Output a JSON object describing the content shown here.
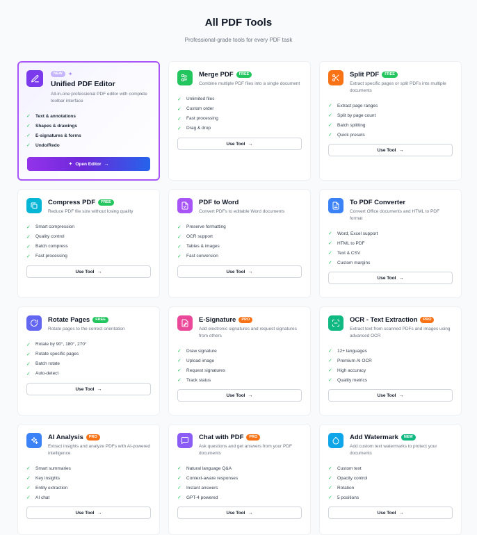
{
  "header": {
    "title": "All PDF Tools",
    "subtitle": "Professional-grade tools for every PDF task"
  },
  "colors": {
    "free": "#22c55e",
    "pro": "#f97316",
    "new": "#10b981",
    "accent_purple": "#a855f7"
  },
  "featured": {
    "badge": "NEW",
    "title": "Unified PDF Editor",
    "description": "All-in-one professional PDF editor with complete toolbar interface",
    "features": [
      "Text & annotations",
      "Shapes & drawings",
      "E-signatures & forms",
      "Undo/Redo"
    ],
    "button_label": "Open Editor",
    "icon": "edit-icon"
  },
  "tools": [
    {
      "title": "Merge PDF",
      "badge": "FREE",
      "description": "Combine multiple PDF files into a single document",
      "features": [
        "Unlimited files",
        "Custom order",
        "Fast processing",
        "Drag & drop"
      ],
      "button": "Use Tool",
      "icon": "merge-icon",
      "icon_color": "#22c55e"
    },
    {
      "title": "Split PDF",
      "badge": "FREE",
      "description": "Extract specific pages or split PDFs into multiple documents",
      "features": [
        "Extract page ranges",
        "Split by page count",
        "Batch splitting",
        "Quick presets"
      ],
      "button": "Use Tool",
      "icon": "scissors-icon",
      "icon_color": "#f97316"
    },
    {
      "title": "Compress PDF",
      "badge": "FREE",
      "description": "Reduce PDF file size without losing quality",
      "features": [
        "Smart compression",
        "Quality control",
        "Batch compress",
        "Fast processing"
      ],
      "button": "Use Tool",
      "icon": "compress-icon",
      "icon_color": "#06b6d4"
    },
    {
      "title": "PDF to Word",
      "badge": "",
      "description": "Convert PDFs to editable Word documents",
      "features": [
        "Preserve formatting",
        "OCR support",
        "Tables & images",
        "Fast conversion"
      ],
      "button": "Use Tool",
      "icon": "convert-doc-icon",
      "icon_color": "#a855f7"
    },
    {
      "title": "To PDF Converter",
      "badge": "",
      "description": "Convert Office documents and HTML to PDF format",
      "features": [
        "Word, Excel support",
        "HTML to PDF",
        "Text & CSV",
        "Custom margins"
      ],
      "button": "Use Tool",
      "icon": "document-icon",
      "icon_color": "#3b82f6"
    },
    {
      "title": "Rotate Pages",
      "badge": "FREE",
      "description": "Rotate pages to the correct orientation",
      "features": [
        "Rotate by 90°, 180°, 270°",
        "Rotate specific pages",
        "Batch rotate",
        "Auto-detect"
      ],
      "button": "Use Tool",
      "icon": "rotate-icon",
      "icon_color": "#6366f1"
    },
    {
      "title": "E-Signature",
      "badge": "PRO",
      "description": "Add electronic signatures and request signatures from others",
      "features": [
        "Draw signature",
        "Upload image",
        "Request signatures",
        "Track status"
      ],
      "button": "Use Tool",
      "icon": "signature-icon",
      "icon_color": "#ec4899"
    },
    {
      "title": "OCR - Text Extraction",
      "badge": "PRO",
      "description": "Extract text from scanned PDFs and images using advanced OCR",
      "features": [
        "12+ languages",
        "Premium AI OCR",
        "High accuracy",
        "Quality metrics"
      ],
      "button": "Use Tool",
      "icon": "scan-icon",
      "icon_color": "#10b981"
    },
    {
      "title": "AI Analysis",
      "badge": "PRO",
      "description": "Extract insights and analyze PDFs with AI-powered intelligence",
      "features": [
        "Smart summaries",
        "Key insights",
        "Entity extraction",
        "AI chat"
      ],
      "button": "Use Tool",
      "icon": "sparkle-icon",
      "icon_color": "#3b82f6"
    },
    {
      "title": "Chat with PDF",
      "badge": "PRO",
      "description": "Ask questions and get answers from your PDF documents",
      "features": [
        "Natural language Q&A",
        "Context-aware responses",
        "Instant answers",
        "GPT-4 powered"
      ],
      "button": "Use Tool",
      "icon": "chat-icon",
      "icon_color": "#8b5cf6"
    },
    {
      "title": "Add Watermark",
      "badge": "NEW",
      "description": "Add custom text watermarks to protect your documents",
      "features": [
        "Custom text",
        "Opacity control",
        "Rotation",
        "5 positions"
      ],
      "button": "Use Tool",
      "icon": "droplet-icon",
      "icon_color": "#0ea5e9"
    }
  ]
}
